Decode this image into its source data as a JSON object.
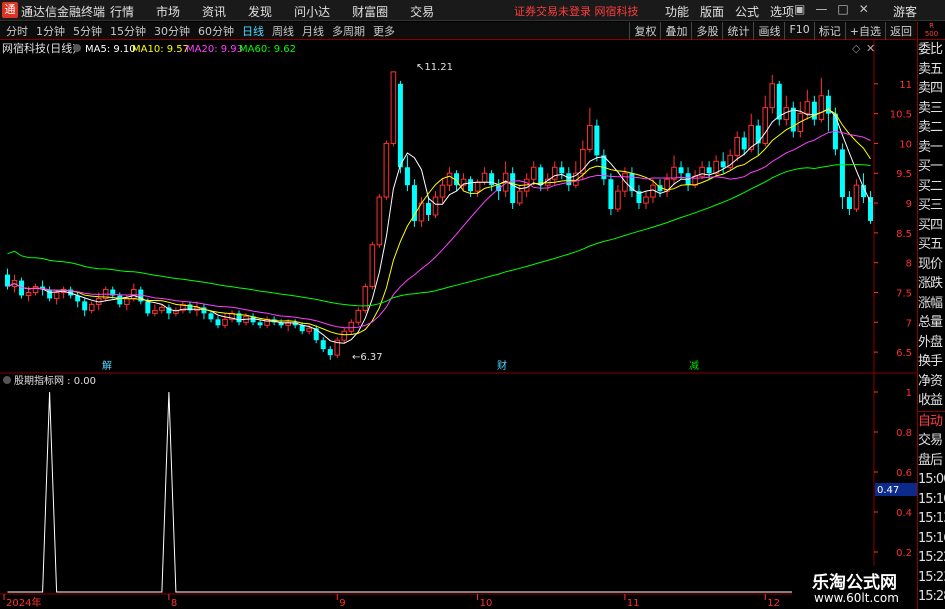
{
  "app": {
    "title": "通达信金融终端",
    "menu": [
      "行情",
      "市场",
      "资讯",
      "发现",
      "问小达",
      "财富圈",
      "交易"
    ],
    "status_message": "证券交易未登录 网宿科技",
    "right_menu": [
      "功能",
      "版面",
      "公式",
      "选项"
    ],
    "guest_label": "游客"
  },
  "toolbar": {
    "periods": [
      "分时",
      "1分钟",
      "5分钟",
      "15分钟",
      "30分钟",
      "60分钟",
      "日线",
      "周线",
      "月线",
      "多周期",
      "更多"
    ],
    "active_period": "日线",
    "buttons": [
      "复权",
      "叠加",
      "多股",
      "统计",
      "画线",
      "F10",
      "标记",
      "+自选",
      "返回"
    ]
  },
  "main_panel": {
    "stock_label": "网宿科技(日线)",
    "ma5": "MA5: 9.10",
    "ma10": "MA10: 9.57",
    "ma20": "MA20: 9.93",
    "ma60": "MA60: 9.62",
    "max_label": "11.21",
    "min_label": "6.37",
    "event_labels": [
      "解",
      "财",
      "减"
    ]
  },
  "sub_panel": {
    "indicator_label": "股期指标网 : 0.00",
    "current_value": "0.47"
  },
  "date_axis": [
    "2024年",
    "8",
    "9",
    "10",
    "11",
    "12"
  ],
  "right_column": {
    "header": "R\n500",
    "items": [
      "委比",
      "卖五",
      "卖四",
      "卖三",
      "卖二",
      "卖一",
      "买一",
      "买二",
      "买三",
      "买四",
      "买五",
      "现价",
      "涨跌",
      "涨幅",
      "总量",
      "外盘",
      "换手",
      "净资",
      "收益"
    ],
    "items2": [
      "自动",
      "交易",
      "盘后",
      "15:00",
      "15:10",
      "15:13",
      "15:16",
      "15:22",
      "15:23",
      "15:28"
    ]
  },
  "watermark": {
    "title": "乐淘公式网",
    "url": "www.60lt.com"
  },
  "colors": {
    "up": "#ff3030",
    "down": "#00ffff",
    "ma5": "#ffffff",
    "ma10": "#ffff00",
    "ma20": "#ff40ff",
    "ma60": "#00ff00",
    "axis_red": "#ff3030"
  },
  "chart_data": [
    {
      "type": "candlestick",
      "title": "网宿科技(日线)",
      "ylim": [
        6.2,
        11.5
      ],
      "yticks": [
        6.5,
        7.0,
        7.5,
        8.0,
        8.5,
        9.0,
        9.5,
        10.0,
        10.5,
        11.0
      ],
      "xticks": [
        "2024年",
        "8",
        "9",
        "10",
        "11",
        "12"
      ],
      "max_label": 11.21,
      "min_label": 6.37,
      "series": [
        {
          "name": "MA5",
          "last": 9.1
        },
        {
          "name": "MA10",
          "last": 9.57
        },
        {
          "name": "MA20",
          "last": 9.93
        },
        {
          "name": "MA60",
          "last": 9.62
        }
      ],
      "candles": [
        [
          7.8,
          7.6,
          7.9,
          7.55
        ],
        [
          7.6,
          7.7,
          7.8,
          7.5
        ],
        [
          7.7,
          7.45,
          7.75,
          7.4
        ],
        [
          7.45,
          7.5,
          7.6,
          7.35
        ],
        [
          7.5,
          7.6,
          7.65,
          7.45
        ],
        [
          7.6,
          7.55,
          7.7,
          7.45
        ],
        [
          7.55,
          7.4,
          7.6,
          7.35
        ],
        [
          7.4,
          7.5,
          7.55,
          7.3
        ],
        [
          7.5,
          7.55,
          7.6,
          7.4
        ],
        [
          7.55,
          7.45,
          7.6,
          7.4
        ],
        [
          7.45,
          7.35,
          7.5,
          7.25
        ],
        [
          7.35,
          7.2,
          7.4,
          7.1
        ],
        [
          7.2,
          7.3,
          7.35,
          7.15
        ],
        [
          7.3,
          7.4,
          7.5,
          7.2
        ],
        [
          7.4,
          7.55,
          7.6,
          7.35
        ],
        [
          7.55,
          7.45,
          7.6,
          7.4
        ],
        [
          7.45,
          7.3,
          7.5,
          7.25
        ],
        [
          7.3,
          7.4,
          7.45,
          7.2
        ],
        [
          7.4,
          7.55,
          7.65,
          7.35
        ],
        [
          7.55,
          7.35,
          7.6,
          7.3
        ],
        [
          7.35,
          7.15,
          7.4,
          7.1
        ],
        [
          7.15,
          7.2,
          7.3,
          7.1
        ],
        [
          7.2,
          7.25,
          7.3,
          7.15
        ],
        [
          7.25,
          7.15,
          7.3,
          7.05
        ],
        [
          7.15,
          7.2,
          7.25,
          7.1
        ],
        [
          7.2,
          7.3,
          7.35,
          7.15
        ],
        [
          7.3,
          7.2,
          7.35,
          7.15
        ],
        [
          7.2,
          7.25,
          7.35,
          7.1
        ],
        [
          7.25,
          7.15,
          7.3,
          7.05
        ],
        [
          7.15,
          7.05,
          7.2,
          7.0
        ],
        [
          7.05,
          6.95,
          7.1,
          6.9
        ],
        [
          6.95,
          7.05,
          7.15,
          6.9
        ],
        [
          7.05,
          7.15,
          7.2,
          7.0
        ],
        [
          7.15,
          7.0,
          7.2,
          6.95
        ],
        [
          7.0,
          7.1,
          7.15,
          6.95
        ],
        [
          7.1,
          7.0,
          7.15,
          6.95
        ],
        [
          7.0,
          6.95,
          7.05,
          6.9
        ],
        [
          6.95,
          7.05,
          7.1,
          6.9
        ],
        [
          7.05,
          7.0,
          7.1,
          6.95
        ],
        [
          7.0,
          6.95,
          7.05,
          6.9
        ],
        [
          6.95,
          7.0,
          7.05,
          6.85
        ],
        [
          7.0,
          6.95,
          7.05,
          6.9
        ],
        [
          6.95,
          6.85,
          7.0,
          6.8
        ],
        [
          6.85,
          6.9,
          6.95,
          6.8
        ],
        [
          6.9,
          6.7,
          6.95,
          6.65
        ],
        [
          6.7,
          6.55,
          6.75,
          6.5
        ],
        [
          6.55,
          6.45,
          6.6,
          6.37
        ],
        [
          6.45,
          6.7,
          6.75,
          6.4
        ],
        [
          6.7,
          6.85,
          6.9,
          6.65
        ],
        [
          6.85,
          7.0,
          7.05,
          6.8
        ],
        [
          7.0,
          7.2,
          7.25,
          6.95
        ],
        [
          7.2,
          7.6,
          7.65,
          7.15
        ],
        [
          7.6,
          8.3,
          8.35,
          7.55
        ],
        [
          8.3,
          9.1,
          9.15,
          8.25
        ],
        [
          9.1,
          10.0,
          10.05,
          9.05
        ],
        [
          10.0,
          11.2,
          11.21,
          9.95
        ],
        [
          11.0,
          9.6,
          11.05,
          9.5
        ],
        [
          9.6,
          9.3,
          9.8,
          9.2
        ],
        [
          9.3,
          8.7,
          9.4,
          8.6
        ],
        [
          8.7,
          9.0,
          9.1,
          8.6
        ],
        [
          9.0,
          8.8,
          9.1,
          8.7
        ],
        [
          8.8,
          9.1,
          9.2,
          8.75
        ],
        [
          9.1,
          9.3,
          9.4,
          9.0
        ],
        [
          9.3,
          9.5,
          9.6,
          9.2
        ],
        [
          9.5,
          9.3,
          9.55,
          9.2
        ],
        [
          9.3,
          9.4,
          9.5,
          9.2
        ],
        [
          9.4,
          9.2,
          9.45,
          9.1
        ],
        [
          9.2,
          9.35,
          9.4,
          9.1
        ],
        [
          9.35,
          9.5,
          9.6,
          9.3
        ],
        [
          9.5,
          9.3,
          9.55,
          9.2
        ],
        [
          9.3,
          9.2,
          9.4,
          9.05
        ],
        [
          9.2,
          9.5,
          9.7,
          9.1
        ],
        [
          9.5,
          9.0,
          9.6,
          8.9
        ],
        [
          9.0,
          9.2,
          9.3,
          8.95
        ],
        [
          9.2,
          9.4,
          9.5,
          9.1
        ],
        [
          9.4,
          9.6,
          9.7,
          9.3
        ],
        [
          9.6,
          9.3,
          9.65,
          9.2
        ],
        [
          9.3,
          9.4,
          9.5,
          9.2
        ],
        [
          9.4,
          9.6,
          9.7,
          9.3
        ],
        [
          9.6,
          9.5,
          9.7,
          9.4
        ],
        [
          9.5,
          9.3,
          9.6,
          9.2
        ],
        [
          9.3,
          9.5,
          9.7,
          9.25
        ],
        [
          9.5,
          9.9,
          10.05,
          9.4
        ],
        [
          9.9,
          10.3,
          10.6,
          9.85
        ],
        [
          10.3,
          9.8,
          10.4,
          9.7
        ],
        [
          9.8,
          9.4,
          9.9,
          9.3
        ],
        [
          9.4,
          8.9,
          9.5,
          8.8
        ],
        [
          8.9,
          9.2,
          9.3,
          8.85
        ],
        [
          9.2,
          9.5,
          9.6,
          9.1
        ],
        [
          9.5,
          9.2,
          9.6,
          9.1
        ],
        [
          9.2,
          9.0,
          9.3,
          8.9
        ],
        [
          9.0,
          9.1,
          9.2,
          8.9
        ],
        [
          9.1,
          9.3,
          9.4,
          9.0
        ],
        [
          9.3,
          9.2,
          9.4,
          9.1
        ],
        [
          9.2,
          9.4,
          9.5,
          9.1
        ],
        [
          9.4,
          9.6,
          9.8,
          9.3
        ],
        [
          9.6,
          9.5,
          9.7,
          9.4
        ],
        [
          9.5,
          9.3,
          9.6,
          9.2
        ],
        [
          9.3,
          9.45,
          9.55,
          9.25
        ],
        [
          9.45,
          9.6,
          9.7,
          9.4
        ],
        [
          9.6,
          9.5,
          9.7,
          9.4
        ],
        [
          9.5,
          9.7,
          9.8,
          9.45
        ],
        [
          9.7,
          9.6,
          9.85,
          9.5
        ],
        [
          9.6,
          9.8,
          9.9,
          9.55
        ],
        [
          9.8,
          10.1,
          10.2,
          9.7
        ],
        [
          10.1,
          9.9,
          10.2,
          9.8
        ],
        [
          9.9,
          10.3,
          10.5,
          9.85
        ],
        [
          10.3,
          10.0,
          10.4,
          9.8
        ],
        [
          10.0,
          10.6,
          10.8,
          9.95
        ],
        [
          10.6,
          11.0,
          11.15,
          10.5
        ],
        [
          11.0,
          10.4,
          11.05,
          10.3
        ],
        [
          10.4,
          10.6,
          10.8,
          10.3
        ],
        [
          10.6,
          10.2,
          10.7,
          10.1
        ],
        [
          10.2,
          10.5,
          10.7,
          10.1
        ],
        [
          10.5,
          10.7,
          10.9,
          10.4
        ],
        [
          10.7,
          10.4,
          10.8,
          10.3
        ],
        [
          10.4,
          10.8,
          11.1,
          10.35
        ],
        [
          10.8,
          10.5,
          10.9,
          10.2
        ],
        [
          10.5,
          9.9,
          10.6,
          9.8
        ],
        [
          9.9,
          9.1,
          10.0,
          8.9
        ],
        [
          9.1,
          8.9,
          9.2,
          8.8
        ],
        [
          8.9,
          9.3,
          9.4,
          8.85
        ],
        [
          9.3,
          9.1,
          9.5,
          9.0
        ],
        [
          9.1,
          8.7,
          9.2,
          8.65
        ]
      ]
    },
    {
      "type": "line",
      "title": "股期指标网",
      "ylim": [
        0,
        1.0
      ],
      "yticks": [
        0.2,
        0.4,
        0.6,
        0.8,
        1.0
      ],
      "values": [
        0,
        0,
        0,
        0,
        0,
        0,
        1,
        0,
        0,
        0,
        0,
        0,
        0,
        0,
        0,
        0,
        0,
        0,
        0,
        0,
        0,
        0,
        0,
        1,
        0,
        0,
        0,
        0,
        0,
        0,
        0,
        0,
        0,
        0,
        0,
        0,
        0,
        0,
        0,
        0,
        0,
        0,
        0,
        0,
        0,
        0,
        0,
        0,
        0,
        0,
        0,
        0,
        0,
        0,
        0,
        0,
        0,
        0,
        0,
        0,
        0,
        0,
        0,
        0,
        0,
        0,
        0,
        0,
        0,
        0,
        0,
        0,
        0,
        0,
        0,
        0,
        0,
        0,
        0,
        0,
        0,
        0,
        0,
        0,
        0,
        0,
        0,
        0,
        0,
        0,
        0,
        0,
        0,
        0,
        0,
        0,
        0,
        0,
        0,
        0,
        0,
        0,
        0,
        0,
        0,
        0,
        0,
        0,
        0,
        0,
        0,
        0,
        0,
        0,
        0,
        0,
        0,
        0,
        0,
        0,
        0,
        0,
        0,
        0,
        0,
        0,
        0,
        0,
        0,
        0
      ]
    }
  ]
}
